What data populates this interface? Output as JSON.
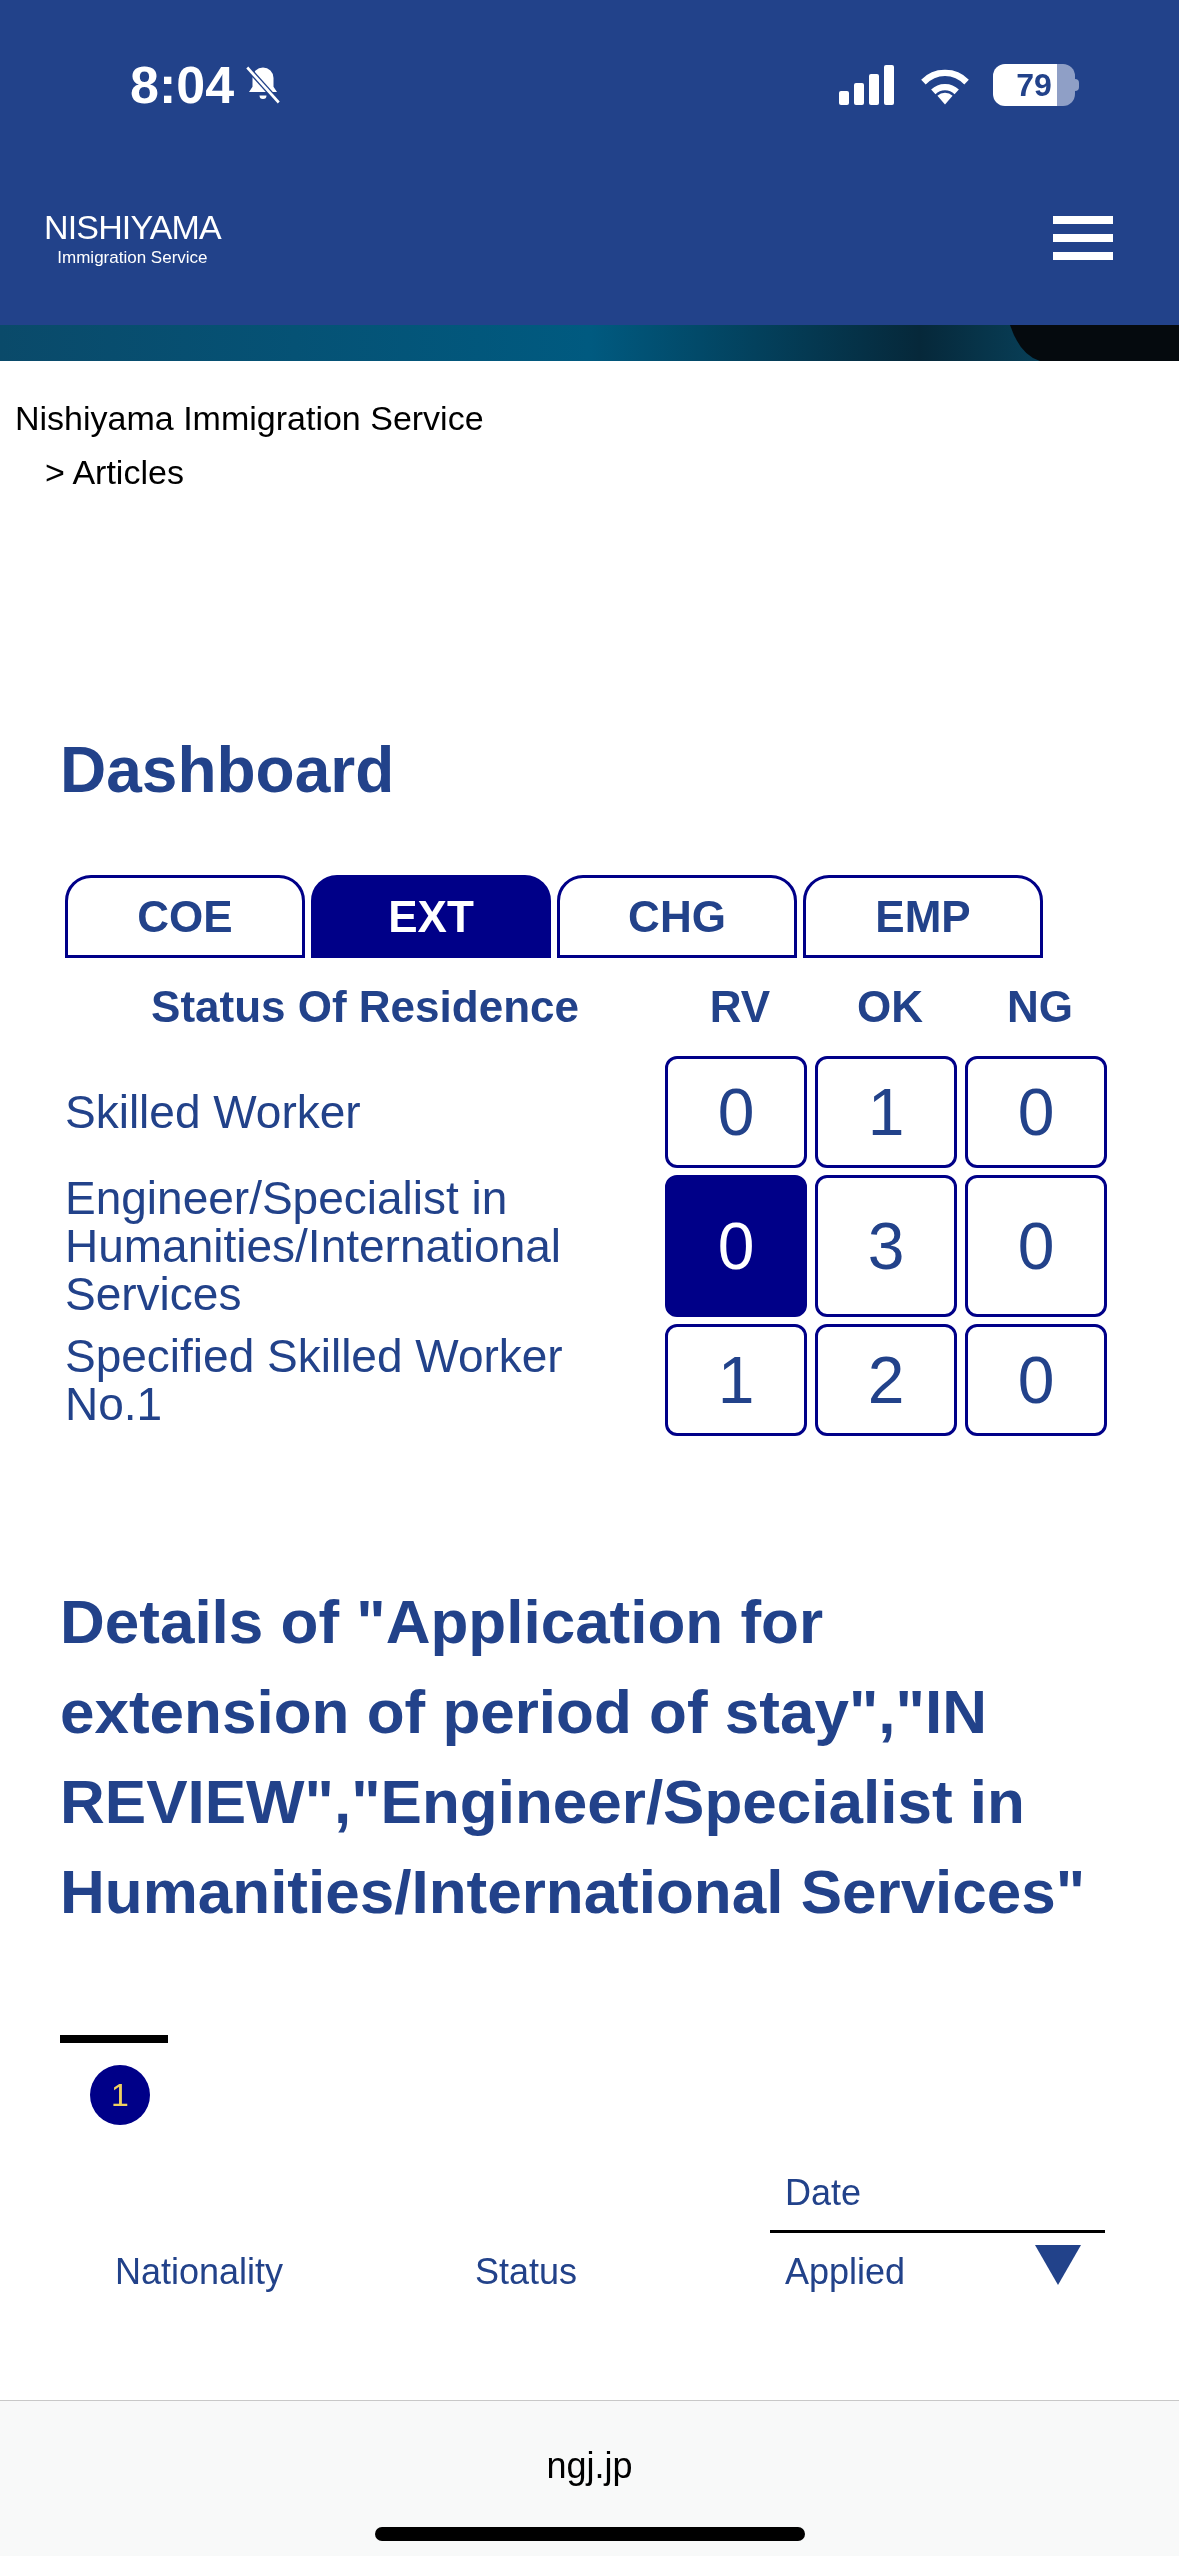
{
  "status_bar": {
    "time": "8:04",
    "battery": "79"
  },
  "header": {
    "logo_title": "NISHIYAMA",
    "logo_subtitle": "Immigration Service"
  },
  "breadcrumb": [
    "Nishiyama Immigration Service",
    "> Articles"
  ],
  "dashboard": {
    "title": "Dashboard",
    "tabs": [
      {
        "label": "COE",
        "selected": false
      },
      {
        "label": "EXT",
        "selected": true
      },
      {
        "label": "CHG",
        "selected": false
      },
      {
        "label": "EMP",
        "selected": false
      }
    ],
    "header": {
      "title": "Status Of Residence",
      "counts": [
        "RV",
        "OK",
        "NG"
      ]
    },
    "rows": [
      {
        "name": "Skilled Worker",
        "cells": [
          {
            "value": "0",
            "selected": false
          },
          {
            "value": "1",
            "selected": false
          },
          {
            "value": "0",
            "selected": false
          }
        ]
      },
      {
        "name": "Engineer/Specialist in Humanities/International Services",
        "cells": [
          {
            "value": "0",
            "selected": true
          },
          {
            "value": "3",
            "selected": false
          },
          {
            "value": "0",
            "selected": false
          }
        ]
      },
      {
        "name": "Specified Skilled Worker No.1",
        "cells": [
          {
            "value": "1",
            "selected": false
          },
          {
            "value": "2",
            "selected": false
          },
          {
            "value": "0",
            "selected": false
          }
        ]
      }
    ]
  },
  "details": {
    "title": "Details of \"Application for extension of period of stay\",\"IN REVIEW\",\"Engineer/Specialist in Humanities/International Services\"",
    "pages": [
      {
        "label": "1",
        "selected": true
      }
    ],
    "group_header": "Date",
    "columns": [
      "Nationality",
      "Status",
      "Applied"
    ]
  },
  "browser": {
    "url": "ngj.jp"
  }
}
